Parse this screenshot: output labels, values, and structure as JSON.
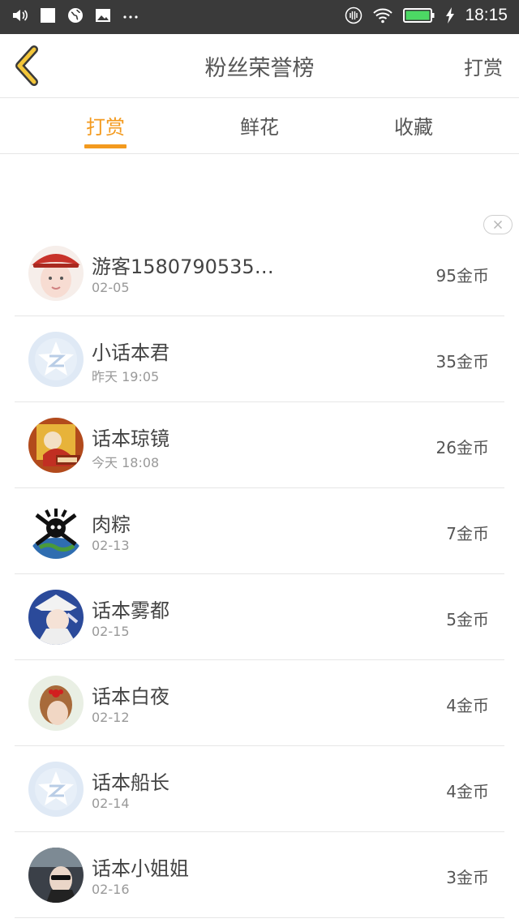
{
  "status_bar": {
    "time": "18:15",
    "icons": [
      "volume-icon",
      "square-icon",
      "globe-icon",
      "image-icon",
      "more-dots-icon",
      "vibrate-icon",
      "wifi-icon",
      "battery-icon",
      "charging-icon"
    ]
  },
  "header": {
    "title": "粉丝荣誉榜",
    "action": "打赏",
    "back_icon": "chevron-left-icon",
    "accent": "#f39a1e"
  },
  "tabs": [
    {
      "label": "打赏",
      "active": true
    },
    {
      "label": "鲜花",
      "active": false
    },
    {
      "label": "收藏",
      "active": false
    }
  ],
  "rows": [
    {
      "name": "游客1580790535…",
      "date": "02-05",
      "coins": "95金币",
      "avatar": "girl-red-hat-avatar"
    },
    {
      "name": "小话本君",
      "date": "昨天 19:05",
      "coins": "35金币",
      "avatar": "default-avatar"
    },
    {
      "name": "话本琼镜",
      "date": "今天 18:08",
      "coins": "26金币",
      "avatar": "cartoon-avatar"
    },
    {
      "name": "肉粽",
      "date": "02-13",
      "coins": "7金币",
      "avatar": "skull-globe-avatar"
    },
    {
      "name": "话本雾都",
      "date": "02-15",
      "coins": "5金币",
      "avatar": "anime-avatar"
    },
    {
      "name": "话本白夜",
      "date": "02-12",
      "coins": "4金币",
      "avatar": "hair-bow-avatar"
    },
    {
      "name": "话本船长",
      "date": "02-14",
      "coins": "4金币",
      "avatar": "default-avatar"
    },
    {
      "name": "话本小姐姐",
      "date": "02-16",
      "coins": "3金币",
      "avatar": "car-selfie-avatar"
    }
  ]
}
